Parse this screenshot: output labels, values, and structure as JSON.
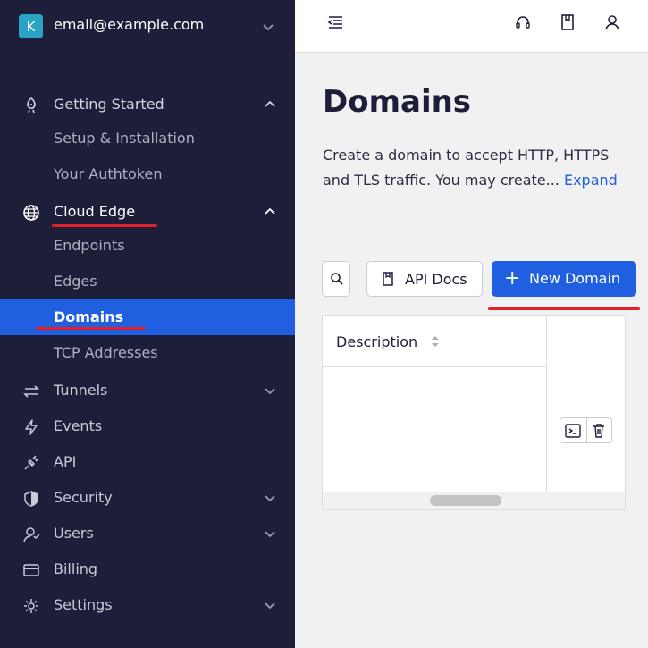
{
  "account": {
    "initial": "K",
    "email": "email@example.com"
  },
  "sidebar": {
    "getting_started": {
      "label": "Getting Started",
      "children": [
        "Setup & Installation",
        "Your Authtoken"
      ]
    },
    "cloud_edge": {
      "label": "Cloud Edge",
      "children": [
        "Endpoints",
        "Edges",
        "Domains",
        "TCP Addresses"
      ],
      "active": "Domains"
    },
    "items": [
      "Tunnels",
      "Events",
      "API",
      "Security",
      "Users",
      "Billing",
      "Settings"
    ]
  },
  "main": {
    "title": "Domains",
    "description": "Create a domain to accept HTTP, HTTPS and TLS traffic. You may create...",
    "expand_link": "Expand",
    "api_docs_label": "API Docs",
    "new_domain_label": "New Domain",
    "table": {
      "columns": [
        "Description"
      ]
    }
  },
  "colors": {
    "sidebar_bg": "#1d1f3a",
    "accent": "#1f5fe0",
    "annotation_red": "#e0202a"
  }
}
